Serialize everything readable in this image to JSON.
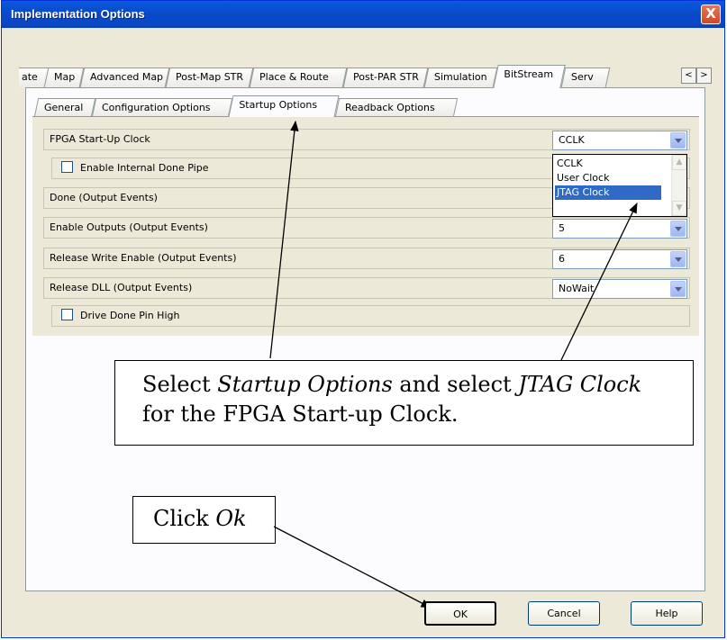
{
  "window": {
    "title": "Implementation Options",
    "close_label": "X"
  },
  "outer_tabs": [
    {
      "label": "ate"
    },
    {
      "label": "Map"
    },
    {
      "label": "Advanced Map"
    },
    {
      "label": "Post-Map STR"
    },
    {
      "label": "Place & Route"
    },
    {
      "label": "Post-PAR STR"
    },
    {
      "label": "Simulation"
    },
    {
      "label": "BitStream",
      "active": true
    },
    {
      "label": "Serv"
    }
  ],
  "outer_scroll": {
    "left": "<",
    "right": ">"
  },
  "inner_tabs": [
    {
      "label": "General"
    },
    {
      "label": "Configuration Options"
    },
    {
      "label": "Startup Options",
      "active": true
    },
    {
      "label": "Readback Options"
    }
  ],
  "options": {
    "fpga_startup_clock": {
      "label": "FPGA Start-Up Clock",
      "value": "CCLK"
    },
    "enable_internal_done_pipe": {
      "label": "Enable Internal Done Pipe",
      "checked": false
    },
    "done": {
      "label": "Done (Output Events)"
    },
    "enable_outputs": {
      "label": "Enable Outputs (Output Events)",
      "value": "5"
    },
    "release_write_enable": {
      "label": "Release Write Enable (Output Events)",
      "value": "6"
    },
    "release_dll": {
      "label": "Release DLL (Output Events)",
      "value": "NoWait"
    },
    "drive_done_pin_high": {
      "label": "Drive Done Pin High",
      "checked": false
    }
  },
  "dropdown": {
    "options": [
      "CCLK",
      "User Clock",
      "JTAG Clock"
    ],
    "highlighted": "JTAG Clock"
  },
  "callouts": {
    "startup_line1_a": "Select ",
    "startup_line1_b": "Startup Options",
    "startup_line1_c": " and select ",
    "startup_line1_d": "JTAG Clock",
    "startup_line2": "for the FPGA Start-up Clock.",
    "ok_a": "Click ",
    "ok_b": "Ok"
  },
  "buttons": {
    "ok": "OK",
    "cancel": "Cancel",
    "help": "Help"
  },
  "colors": {
    "titlebar": "#0a49c9",
    "selection": "#316ac5",
    "face": "#ece9d8"
  }
}
